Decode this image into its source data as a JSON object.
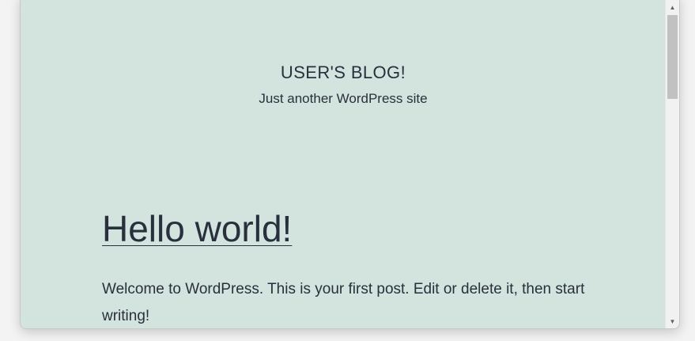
{
  "site": {
    "title": "USER'S BLOG!",
    "tagline": "Just another WordPress site"
  },
  "post": {
    "title": "Hello world!",
    "excerpt": "Welcome to WordPress. This is your first post. Edit or delete it, then start writing!"
  },
  "scrollbar": {
    "up_icon": "▲",
    "down_icon": "▼"
  },
  "colors": {
    "background": "#d2e4dd",
    "text": "#28303d"
  }
}
